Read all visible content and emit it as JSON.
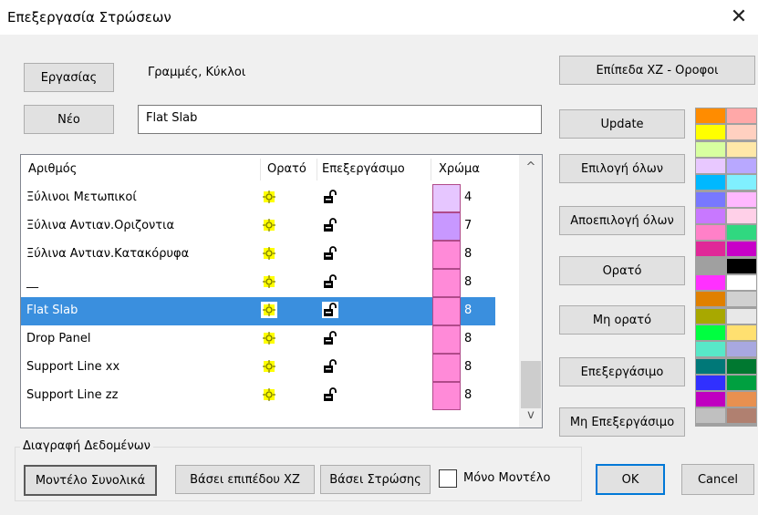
{
  "window": {
    "title": "Επεξεργασία Στρώσεων",
    "close_glyph": "✕"
  },
  "top": {
    "btn_ergasias": "Εργασίας",
    "category_label": "Γραμμές, Κύκλοι",
    "btn_neo": "Νέο",
    "name_value": "Flat Slab"
  },
  "list": {
    "headers": {
      "number": "Αριθμός",
      "visible": "Ορατό",
      "editable": "Επεξεργάσιμο",
      "color": "Χρώμα"
    },
    "rows": [
      {
        "name": "Ξύλινοι Μετωπικοί",
        "color": "#e6c6ff",
        "num": "4",
        "selected": false
      },
      {
        "name": "Ξύλινα Αντιαν.Οριζοντια",
        "color": "#c898ff",
        "num": "7",
        "selected": false
      },
      {
        "name": "Ξύλινα Αντιαν.Κατακόρυφα",
        "color": "#ff8ad8",
        "num": "8",
        "selected": false
      },
      {
        "name": "__",
        "color": "#ff8ad8",
        "num": "8",
        "selected": false
      },
      {
        "name": "Flat Slab",
        "color": "#ff8ad8",
        "num": "8",
        "selected": true
      },
      {
        "name": "Drop Panel",
        "color": "#ff8ad8",
        "num": "8",
        "selected": false
      },
      {
        "name": "Support Line xx",
        "color": "#ff8ad8",
        "num": "8",
        "selected": false
      },
      {
        "name": "Support Line zz",
        "color": "#ff8ad8",
        "num": "8",
        "selected": false
      }
    ],
    "scroll_up": "^",
    "scroll_down": "v"
  },
  "right_buttons": {
    "levels": "Επίπεδα XZ - Οροφοι",
    "update": "Update",
    "select_all": "Επιλογή όλων",
    "deselect_all": "Αποεπιλογή όλων",
    "visible": "Ορατό",
    "not_visible": "Μη ορατό",
    "editable": "Επεξεργάσιμο",
    "not_editable": "Μη Επεξεργάσιμο"
  },
  "bottom": {
    "group_label": "Διαγραφή Δεδομένων",
    "btn_model_total": "Μοντέλο Συνολικά",
    "btn_by_level": "Βάσει επιπέδου XZ",
    "btn_by_layer": "Βάσει Στρώσης",
    "only_model_label": "Μόνο Μοντέλο",
    "only_model_checked": false,
    "ok": "OK",
    "cancel": "Cancel"
  },
  "palette": [
    [
      "#ff8c00",
      "#ffa8a8"
    ],
    [
      "#ffff00",
      "#ffd0c0"
    ],
    [
      "#d8ffa0",
      "#ffe8a8"
    ],
    [
      "#e8c8ff",
      "#b8a8ff"
    ],
    [
      "#00b8ff",
      "#80f0ff"
    ],
    [
      "#7878ff",
      "#ffb8ff"
    ],
    [
      "#c878ff",
      "#ffd0e8"
    ],
    [
      "#ff80c8",
      "#30d880"
    ],
    [
      "#e02898",
      "#c800c8"
    ],
    [
      "#a0a0a0",
      "#000000"
    ],
    [
      "#ff30ff",
      "#ffffff"
    ],
    [
      "#e08000",
      "#d0d0d0"
    ],
    [
      "#a8a800",
      "#e8e8e8"
    ],
    [
      "#00ff40",
      "#ffe070"
    ],
    [
      "#58e8c8",
      "#a8a8e0"
    ],
    [
      "#007878",
      "#007830"
    ],
    [
      "#3030ff",
      "#00a040"
    ],
    [
      "#c000c0",
      "#e89050"
    ],
    [
      "#c0c0c0",
      "#b08070"
    ]
  ]
}
